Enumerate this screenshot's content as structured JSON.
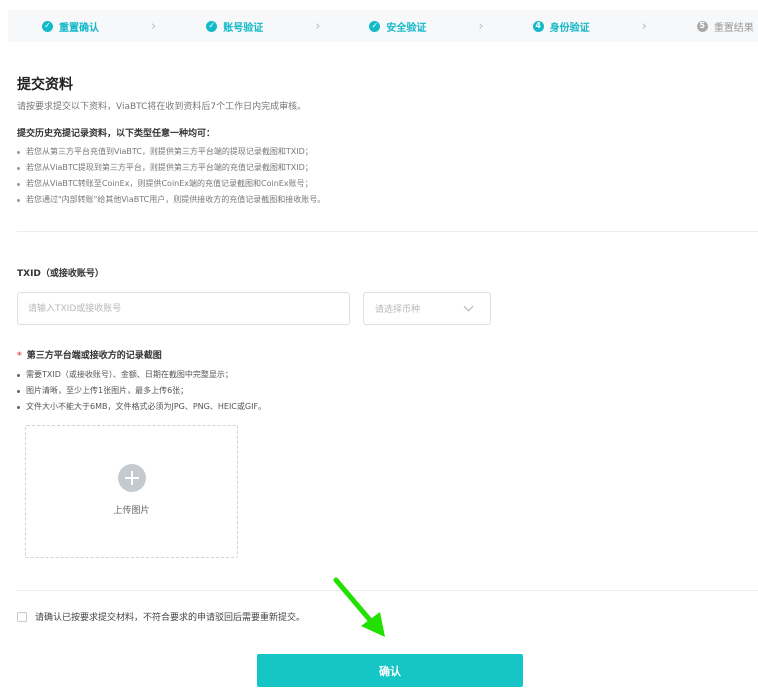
{
  "stepper": {
    "steps": [
      {
        "label": "重置确认",
        "state": "done",
        "icon": "check-icon"
      },
      {
        "label": "账号验证",
        "state": "done",
        "icon": "check-icon"
      },
      {
        "label": "安全验证",
        "state": "done",
        "icon": "check-icon"
      },
      {
        "label": "身份验证",
        "state": "current",
        "number": "4"
      },
      {
        "label": "重置结果",
        "state": "pending",
        "number": "5"
      }
    ]
  },
  "section": {
    "title": "提交资料",
    "description": "请按要求提交以下资料，ViaBTC将在收到资料后7个工作日内完成审核。",
    "subtitle": "提交历史充提记录资料，以下类型任意一种均可：",
    "bullets": [
      "若您从第三方平台充值到ViaBTC，则提供第三方平台端的提现记录截图和TXID；",
      "若您从ViaBTC提现到第三方平台，则提供第三方平台端的充值记录截图和TXID；",
      "若您从ViaBTC转账至CoinEx，则提供CoinEx端的充值记录截图和CoinEx账号；",
      "若您通过\"内部转账\"给其他ViaBTC用户，则提供接收方的充值记录截图和接收账号。"
    ]
  },
  "txid": {
    "label": "TXID（或接收账号）",
    "placeholder": "请输入TXID或接收账号",
    "coin_placeholder": "请选择币种"
  },
  "upload": {
    "required_mark": "*",
    "label": "第三方平台端或接收方的记录截图",
    "rules": [
      "需要TXID（或接收账号）、金额、日期在截图中完整显示；",
      "图片清晰，至少上传1张图片，最多上传6张；",
      "文件大小不能大于6MB，文件格式必须为JPG、PNG、HEIC或GIF。"
    ],
    "button_text": "上传图片"
  },
  "confirm": {
    "checkbox_label": "请确认已按要求提交材料，不符合要求的申请驳回后需要重新提交。",
    "submit_label": "确认"
  },
  "colors": {
    "accent": "#14b9c8",
    "button": "#16c6c6",
    "annotation_arrow": "#22e000"
  }
}
